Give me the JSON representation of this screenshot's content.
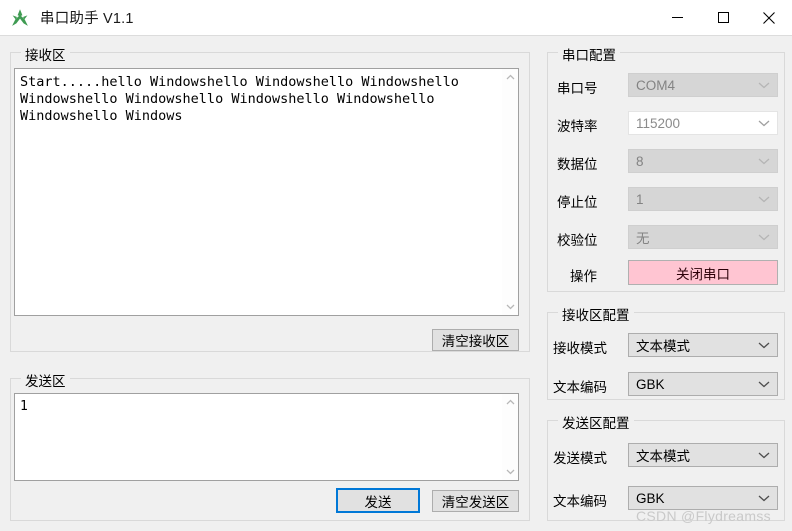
{
  "window": {
    "title": "串口助手 V1.1",
    "app_icon": "app-logo-icon",
    "controls": {
      "minimize": "minimize-icon",
      "maximize": "maximize-icon",
      "close": "close-icon"
    }
  },
  "receive_panel": {
    "group_title": "接收区",
    "text": "Start.....hello Windowshello Windowshello Windowshello Windowshello Windowshello Windowshello Windowshello Windowshello Windows",
    "clear_button": "清空接收区"
  },
  "send_panel": {
    "group_title": "发送区",
    "text": "1",
    "send_button": "发送",
    "clear_button": "清空发送区"
  },
  "serial_config": {
    "group_title": "串口配置",
    "rows": [
      {
        "label": "串口号",
        "value": "COM4",
        "state": "disabled"
      },
      {
        "label": "波特率",
        "value": "115200",
        "state": "disabled-white"
      },
      {
        "label": "数据位",
        "value": "8",
        "state": "disabled"
      },
      {
        "label": "停止位",
        "value": "1",
        "state": "disabled"
      },
      {
        "label": "校验位",
        "value": "无",
        "state": "disabled"
      }
    ],
    "action_label": "操作",
    "action_button": "关闭串口",
    "action_button_bg": "#ffc5d2",
    "action_button_fg": "#2b0008"
  },
  "receive_config": {
    "group_title": "接收区配置",
    "rows": [
      {
        "label": "接收模式",
        "value": "文本模式"
      },
      {
        "label": "文本编码",
        "value": "GBK"
      }
    ]
  },
  "send_config": {
    "group_title": "发送区配置",
    "rows": [
      {
        "label": "发送模式",
        "value": "文本模式"
      },
      {
        "label": "文本编码",
        "value": "GBK"
      }
    ]
  },
  "watermark": "CSDN @Flydreamss"
}
